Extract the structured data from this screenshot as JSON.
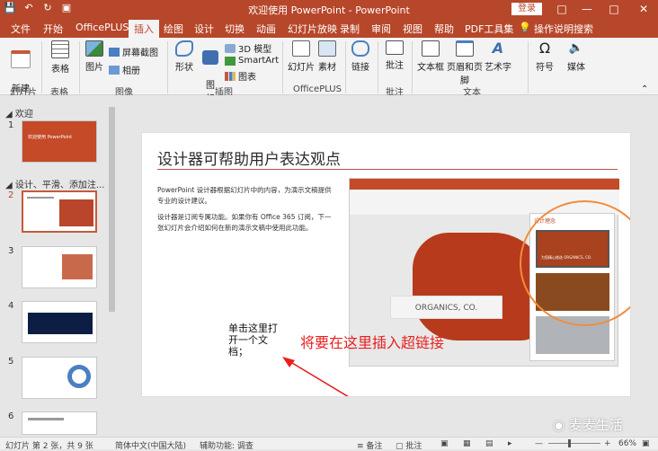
{
  "window": {
    "title": "欢迎使用 PowerPoint  -  PowerPoint",
    "login": "登录"
  },
  "tabs": [
    "文件",
    "开始",
    "OfficePLUS",
    "插入",
    "绘图",
    "设计",
    "切换",
    "动画",
    "幻灯片放映",
    "录制",
    "审阅",
    "视图",
    "帮助",
    "PDF工具集",
    "操作说明搜索"
  ],
  "active_tab": "插入",
  "ribbon": {
    "buttons": {
      "new_slide": "新建\n幻灯片",
      "table": "表格",
      "image": "图片",
      "screenshot": "屏幕截图",
      "album": "相册",
      "shape": "形状",
      "icon": "图\n标",
      "model3d": "3D 模型",
      "smartart": "SmartArt",
      "chart": "图表",
      "slide_btn": "幻灯片",
      "material": "素材",
      "link": "链接",
      "comment": "批注",
      "textbox": "文本框",
      "header_footer": "页眉和页脚",
      "wordart": "艺术字",
      "symbol": "符号",
      "media": "媒体"
    },
    "groups": [
      "幻灯片",
      "表格",
      "图像",
      "插图",
      "OfficePLUS",
      "批注",
      "文本"
    ]
  },
  "slides_panel": {
    "sections": [
      "欢迎",
      "设计、平滑、添加注..."
    ],
    "numbers": [
      "1",
      "2",
      "3",
      "4",
      "5",
      "6"
    ],
    "thumb1_title": "欢迎使用 PowerPoint",
    "current": "2"
  },
  "slide": {
    "title": "设计器可帮助用户表达观点",
    "para1": "PowerPoint 设计器根据幻灯片中的内容，为演示文稿提供专业的设计建议。",
    "para2": "设计器是订阅专属功能。如果你有 Office 365 订阅，下一张幻灯片会介绍如何在新的演示文稿中使用此功能。",
    "screenshot_label": "ORGANICS, CO.",
    "pane_title": "设计理念",
    "pane_item_label": "为您精心挑选 ORGANICS, CO."
  },
  "annotations": {
    "placeholder_text": "单击这里打开一个文档；",
    "instruction": "将要在这里插入超链接"
  },
  "status": {
    "slide_count": "幻灯片 第 2 张，共 9 张",
    "language": "简体中文(中国大陆)",
    "accessibility": "辅助功能: 调查",
    "notes": "备注",
    "comments": "批注",
    "zoom": "66%"
  },
  "watermark": "麦麦生活",
  "colors": {
    "accent": "#b7472a",
    "annotation_red": "#e8201f",
    "circle": "#f28c3d"
  }
}
